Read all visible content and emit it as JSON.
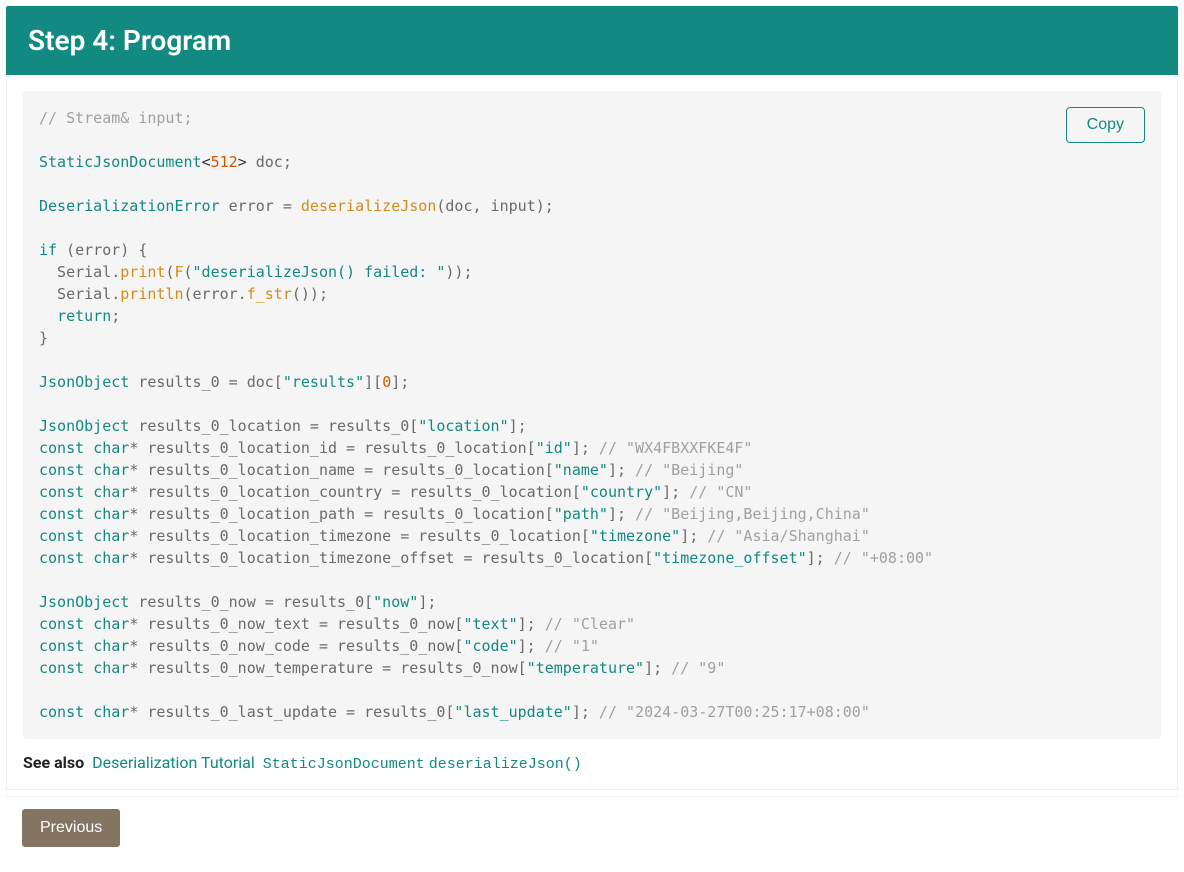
{
  "header": {
    "title": "Step 4: Program"
  },
  "copy": {
    "label": "Copy"
  },
  "code": {
    "c1": "// Stream& input;",
    "l2a": "StaticJsonDocument",
    "l2b": "512",
    "l2c": " doc;",
    "l3a": "DeserializationError",
    "l3b": " error = ",
    "l3fn": "deserializeJson",
    "l3c": "(doc, input);",
    "l4kw": "if",
    "l4a": " (error) {",
    "l5a": "  Serial.",
    "l5fn": "print",
    "l5b": "(",
    "l5fn2": "F",
    "l5c": "(",
    "l5str": "\"deserializeJson() failed: \"",
    "l5d": "));",
    "l6a": "  Serial.",
    "l6fn": "println",
    "l6b": "(error.",
    "l6fn2": "f_str",
    "l6c": "());",
    "l7kw": "return",
    "l7a": ";",
    "l8": "}",
    "l9a": "JsonObject",
    "l9b": " results_0 = doc[",
    "l9s": "\"results\"",
    "l9c": "][",
    "l9n": "0",
    "l9d": "];",
    "l10a": "JsonObject",
    "l10b": " results_0_location = results_0[",
    "l10s": "\"location\"",
    "l10c": "];",
    "l11a": "const",
    "l11b": "char",
    "l11c": "* results_0_location_id = results_0_location[",
    "l11s": "\"id\"",
    "l11d": "]; ",
    "l11cm": "// \"WX4FBXXFKE4F\"",
    "l12a": "const",
    "l12b": "char",
    "l12c": "* results_0_location_name = results_0_location[",
    "l12s": "\"name\"",
    "l12d": "]; ",
    "l12cm": "// \"Beijing\"",
    "l13a": "const",
    "l13b": "char",
    "l13c": "* results_0_location_country = results_0_location[",
    "l13s": "\"country\"",
    "l13d": "]; ",
    "l13cm": "// \"CN\"",
    "l14a": "const",
    "l14b": "char",
    "l14c": "* results_0_location_path = results_0_location[",
    "l14s": "\"path\"",
    "l14d": "]; ",
    "l14cm": "// \"Beijing,Beijing,China\"",
    "l15a": "const",
    "l15b": "char",
    "l15c": "* results_0_location_timezone = results_0_location[",
    "l15s": "\"timezone\"",
    "l15d": "]; ",
    "l15cm": "// \"Asia/Shanghai\"",
    "l16a": "const",
    "l16b": "char",
    "l16c": "* results_0_location_timezone_offset = results_0_location[",
    "l16s": "\"timezone_offset\"",
    "l16d": "]; ",
    "l16cm": "// \"+08:00\"",
    "l17a": "JsonObject",
    "l17b": " results_0_now = results_0[",
    "l17s": "\"now\"",
    "l17c": "];",
    "l18a": "const",
    "l18b": "char",
    "l18c": "* results_0_now_text = results_0_now[",
    "l18s": "\"text\"",
    "l18d": "]; ",
    "l18cm": "// \"Clear\"",
    "l19a": "const",
    "l19b": "char",
    "l19c": "* results_0_now_code = results_0_now[",
    "l19s": "\"code\"",
    "l19d": "]; ",
    "l19cm": "// \"1\"",
    "l20a": "const",
    "l20b": "char",
    "l20c": "* results_0_now_temperature = results_0_now[",
    "l20s": "\"temperature\"",
    "l20d": "]; ",
    "l20cm": "// \"9\"",
    "l21a": "const",
    "l21b": "char",
    "l21c": "* results_0_last_update = results_0[",
    "l21s": "\"last_update\"",
    "l21d": "]; ",
    "l21cm": "// \"2024-03-27T00:25:17+08:00\""
  },
  "see_also": {
    "label": "See also",
    "link1": "Deserialization Tutorial",
    "link2": "StaticJsonDocument",
    "link3": "deserializeJson()"
  },
  "footer": {
    "prev": "Previous"
  }
}
